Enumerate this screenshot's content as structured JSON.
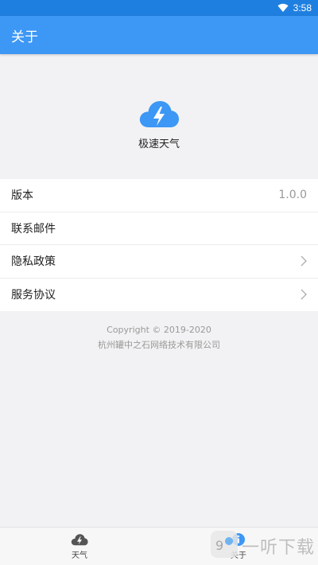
{
  "status_bar": {
    "time": "3:58",
    "wifi_icon": "wifi-icon"
  },
  "app_bar": {
    "title": "关于"
  },
  "hero": {
    "logo_icon": "cloud-lightning-icon",
    "app_name": "极速天气"
  },
  "settings": {
    "items": [
      {
        "label": "版本",
        "value": "1.0.0"
      },
      {
        "label": "联系邮件",
        "value": ""
      },
      {
        "label": "隐私政策",
        "chevron": true
      },
      {
        "label": "服务协议",
        "chevron": true
      }
    ]
  },
  "footer": {
    "copyright": "Copyright © 2019-2020",
    "company": "杭州罐中之石网络技术有限公司"
  },
  "tab_bar": {
    "tabs": [
      {
        "label": "天气",
        "icon": "cloud-lightning-icon"
      },
      {
        "label": "关于",
        "icon": "info-icon"
      }
    ]
  },
  "watermark": {
    "text": "一听下载"
  },
  "colors": {
    "primary": "#3d97f5",
    "status_bar": "#1f7fe0",
    "background": "#f2f2f4"
  }
}
